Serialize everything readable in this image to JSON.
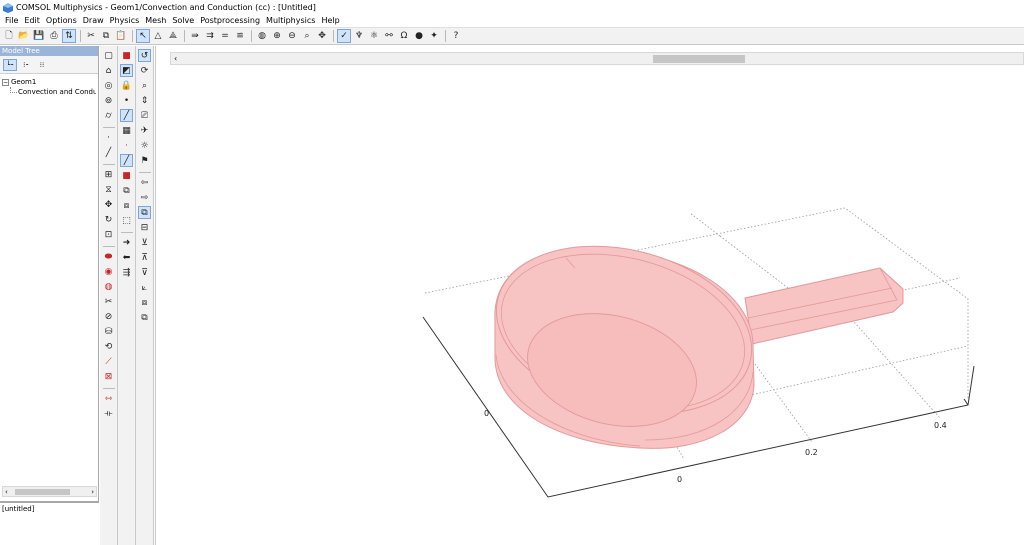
{
  "window": {
    "title": "COMSOL Multiphysics - Geom1/Convection and Conduction (cc) : [Untitled]"
  },
  "menu": [
    "File",
    "Edit",
    "Options",
    "Draw",
    "Physics",
    "Mesh",
    "Solve",
    "Postprocessing",
    "Multiphysics",
    "Help"
  ],
  "model_tree": {
    "header": "Model Tree",
    "root": "Geom1",
    "child": "Convection and Conduction"
  },
  "status_box": {
    "text": "[untitled]"
  },
  "axes": {
    "x_ticks": [
      "0",
      "0.2",
      "0.4"
    ],
    "y_tick": "0"
  },
  "colors": {
    "geometry_fill": "#f8c3c3",
    "geometry_edge": "#e39a9a",
    "accent": "#9ab5d8"
  }
}
